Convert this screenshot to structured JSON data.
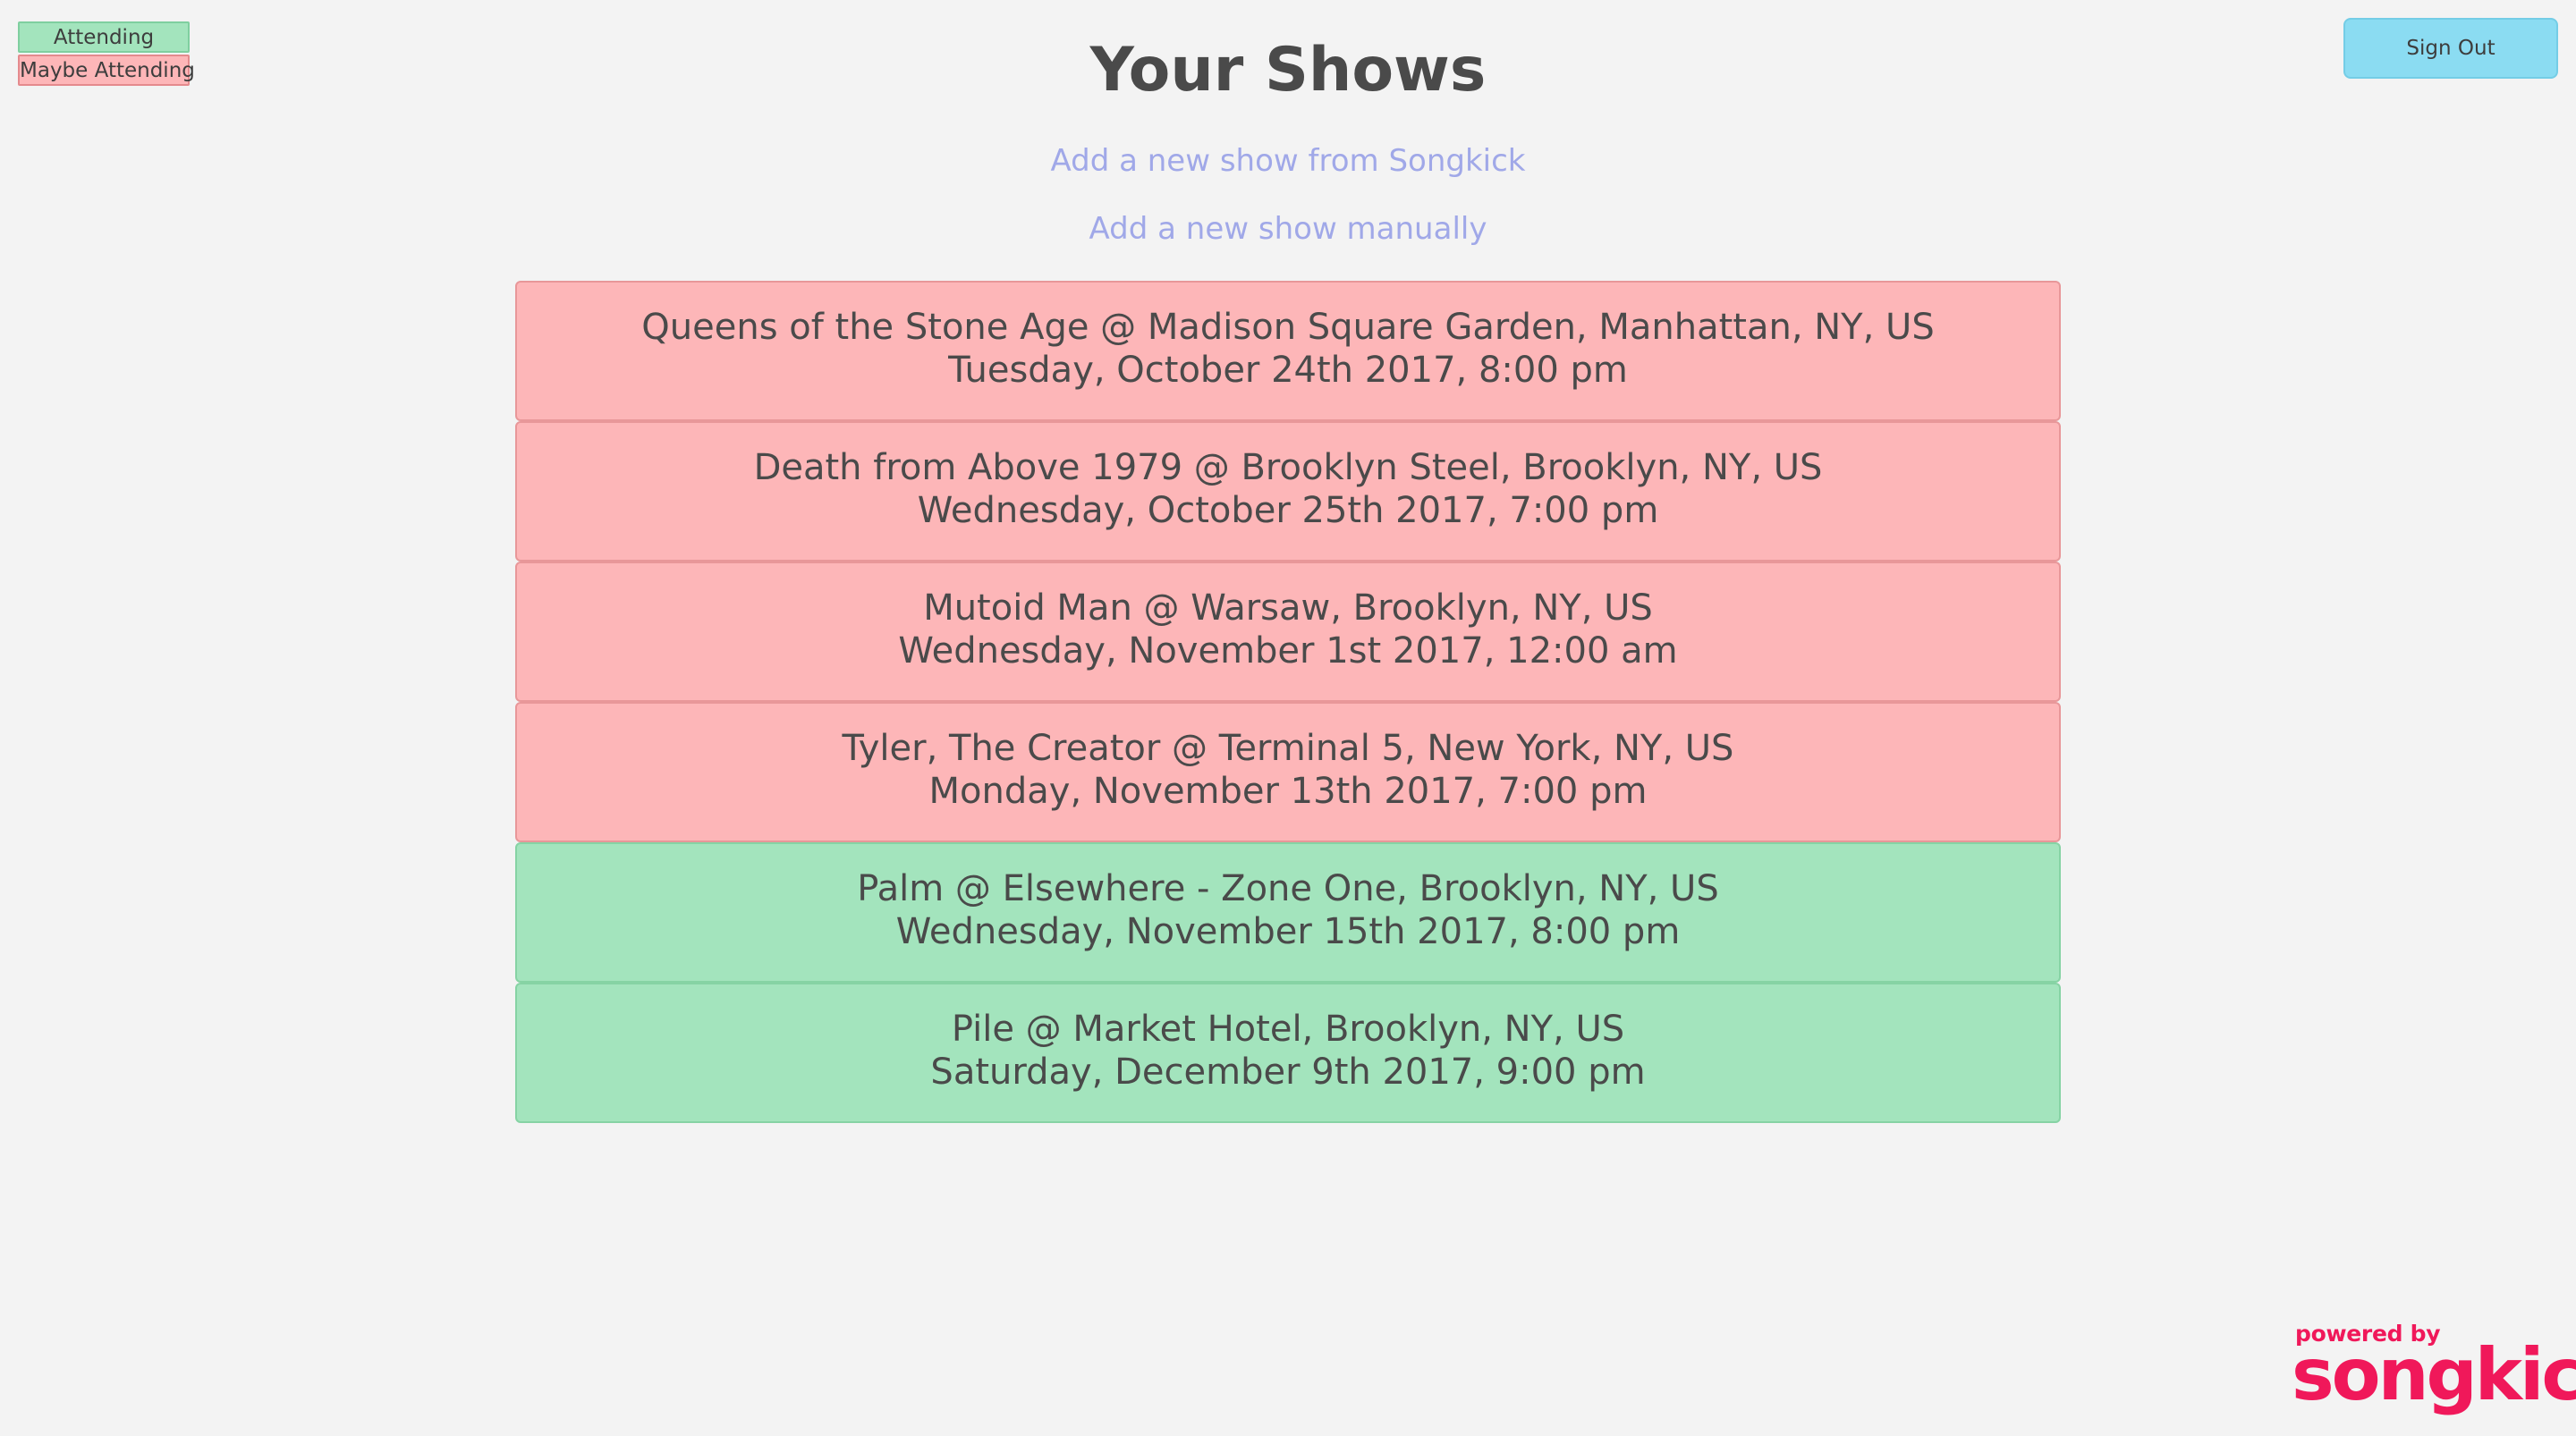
{
  "legend": {
    "attending_label": "Attending",
    "maybe_label": "Maybe Attending"
  },
  "header": {
    "title": "Your Shows",
    "sign_out_label": "Sign Out"
  },
  "actions": {
    "add_from_songkick": "Add a new show from Songkick",
    "add_manually": "Add a new show manually"
  },
  "shows": [
    {
      "status": "maybe",
      "title": "Queens of the Stone Age @ Madison Square Garden, Manhattan, NY, US",
      "date": "Tuesday, October 24th 2017, 8:00 pm"
    },
    {
      "status": "maybe",
      "title": "Death from Above 1979 @ Brooklyn Steel, Brooklyn, NY, US",
      "date": "Wednesday, October 25th 2017, 7:00 pm"
    },
    {
      "status": "maybe",
      "title": "Mutoid Man @ Warsaw, Brooklyn, NY, US",
      "date": "Wednesday, November 1st 2017, 12:00 am"
    },
    {
      "status": "maybe",
      "title": "Tyler, The Creator @ Terminal 5, New York, NY, US",
      "date": "Monday, November 13th 2017, 7:00 pm"
    },
    {
      "status": "attending",
      "title": "Palm @ Elsewhere - Zone One, Brooklyn, NY, US",
      "date": "Wednesday, November 15th 2017, 8:00 pm"
    },
    {
      "status": "attending",
      "title": "Pile @ Market Hotel, Brooklyn, NY, US",
      "date": "Saturday, December 9th 2017, 9:00 pm"
    }
  ],
  "footer": {
    "powered_by": "powered by",
    "brand": "songkick"
  },
  "colors": {
    "background": "#f3f3f3",
    "attending": "#a3e4bd",
    "maybe_attending": "#fdb6b8",
    "sign_out": "#8bdcf2",
    "link": "#a0a8e8",
    "brand": "#f0185a"
  }
}
